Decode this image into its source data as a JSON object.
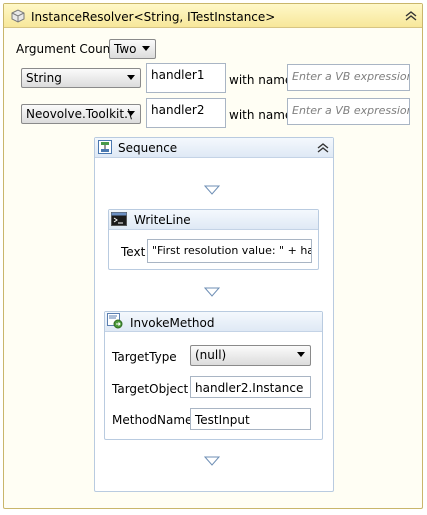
{
  "resolver": {
    "title": "InstanceResolver<String, ITestInstance>",
    "argument_count_label": "Argument Count:",
    "argument_count_value": "Two",
    "rows": [
      {
        "type": "String",
        "handler": "handler1",
        "with_name": "with name",
        "expression_placeholder": "Enter a VB expression"
      },
      {
        "type": "Neovolve.Toolkit.\\",
        "handler": "handler2",
        "with_name": "with name",
        "expression_placeholder": "Enter a VB expression"
      }
    ]
  },
  "sequence": {
    "title": "Sequence",
    "writeline": {
      "title": "WriteLine",
      "text_label": "Text",
      "text_value": "\"First resolution value: \" + har"
    },
    "invoke": {
      "title": "InvokeMethod",
      "target_type_label": "TargetType",
      "target_type_value": "(null)",
      "target_object_label": "TargetObject",
      "target_object_value": "handler2.Instance",
      "method_name_label": "MethodName",
      "method_name_value": "TestInput"
    }
  },
  "colors": {
    "outer_border": "#c9b66b",
    "outer_header": "#f7e79a",
    "sequence_border": "#b9cbe0",
    "arrow": "#6f8fb5"
  },
  "icons": {
    "resolver": "activity-box-icon",
    "sequence": "sequence-icon",
    "writeline": "console-icon",
    "invoke": "invoke-method-icon",
    "collapse": "double-chevron-up-icon",
    "drop": "drop-target-arrow-icon"
  }
}
